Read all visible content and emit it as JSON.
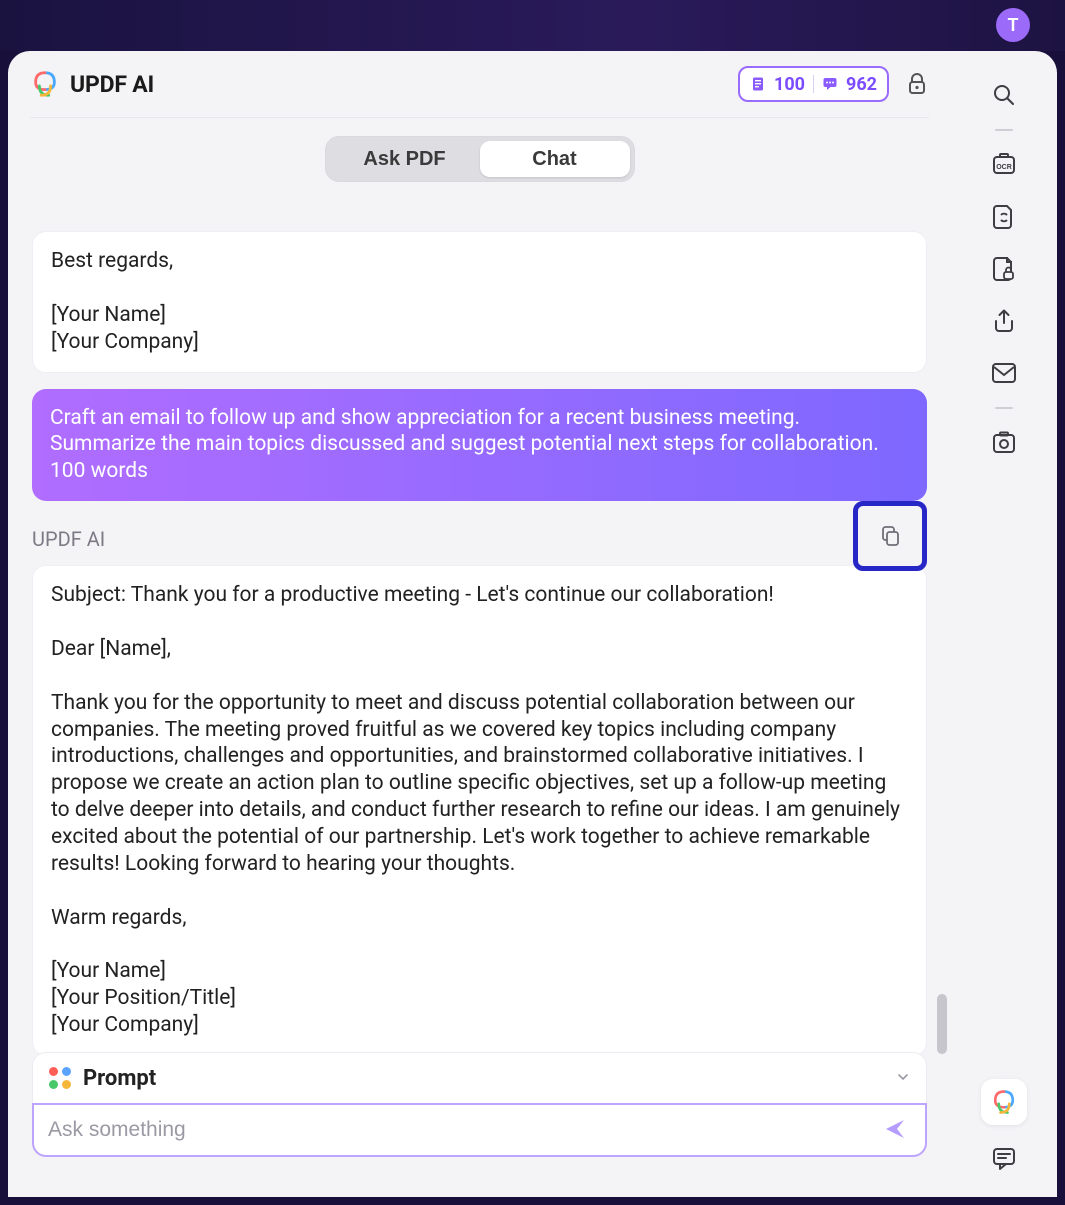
{
  "avatar_initial": "T",
  "header": {
    "title": "UPDF AI",
    "credits": {
      "doc_count": "100",
      "msg_count": "962"
    }
  },
  "tabs": {
    "ask_pdf": "Ask PDF",
    "chat": "Chat",
    "active": "chat"
  },
  "conversation": {
    "assistant_prev": "Best regards,\n\n[Your Name]\n[Your Company]",
    "user_prompt": "Craft an email to follow up and show appreciation for a recent business meeting. Summarize the main topics discussed and suggest potential next steps for collaboration. 100 words",
    "response_label": "UPDF AI",
    "assistant_response": "Subject: Thank you for a productive meeting - Let's continue our collaboration!\n\nDear [Name],\n\nThank you for the opportunity to meet and discuss potential collaboration between our companies. The meeting proved fruitful as we covered key topics including company introductions, challenges and opportunities, and brainstormed collaborative initiatives. I propose we create an action plan to outline specific objectives, set up a follow-up meeting to delve deeper into details, and conduct further research to refine our ideas. I am genuinely excited about the potential of our partnership. Let's work together to achieve remarkable results! Looking forward to hearing your thoughts.\n\nWarm regards,\n\n[Your Name]\n[Your Position/Title]\n[Your Company]"
  },
  "input": {
    "prompt_label": "Prompt",
    "placeholder": "Ask something"
  }
}
